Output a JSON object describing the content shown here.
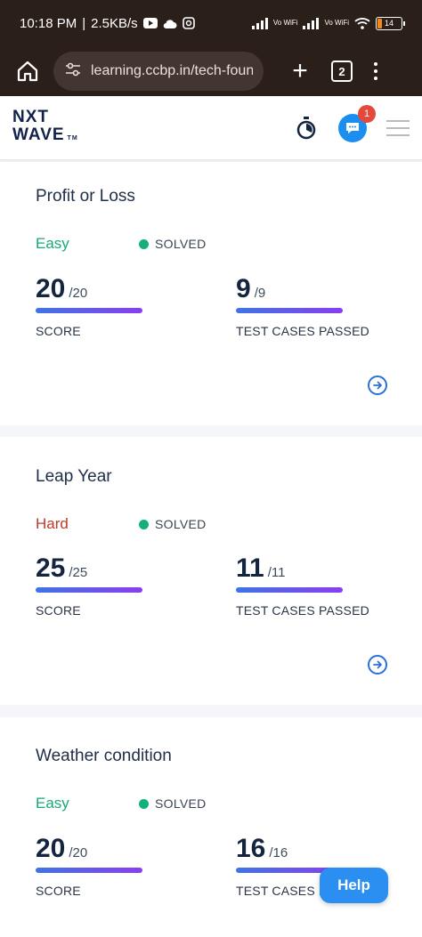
{
  "status_bar": {
    "time": "10:18 PM",
    "speed": "2.5KB/s",
    "sim1": "Vo WiFi",
    "sim2": "Vo WiFi",
    "battery": "14"
  },
  "browser": {
    "url": "learning.ccbp.in/tech-found",
    "tab_count": "2"
  },
  "header": {
    "logo_line1": "NXT",
    "logo_line2": "WAVE",
    "logo_tm": "TM",
    "notification_count": "1"
  },
  "questions": [
    {
      "title": "Profit or Loss",
      "difficulty": "Easy",
      "difficulty_color": "#1aa873",
      "status": "SOLVED",
      "score": "20",
      "score_total": "/20",
      "score_label": "SCORE",
      "tests_passed": "9",
      "tests_total": "/9",
      "tests_label": "TEST CASES PASSED"
    },
    {
      "title": "Leap Year",
      "difficulty": "Hard",
      "difficulty_color": "#c0392b",
      "status": "SOLVED",
      "score": "25",
      "score_total": "/25",
      "score_label": "SCORE",
      "tests_passed": "11",
      "tests_total": "/11",
      "tests_label": "TEST CASES PASSED"
    },
    {
      "title": "Weather condition",
      "difficulty": "Easy",
      "difficulty_color": "#1aa873",
      "status": "SOLVED",
      "score": "20",
      "score_total": "/20",
      "score_label": "SCORE",
      "tests_passed": "16",
      "tests_total": "/16",
      "tests_label": "TEST CASES PA"
    }
  ],
  "help_label": "Help",
  "colors": {
    "accent_blue": "#2a8ff0",
    "bar_gradient_start": "#3f74e6",
    "bar_gradient_end": "#8a3ef0",
    "solved_dot": "#12b07a"
  }
}
